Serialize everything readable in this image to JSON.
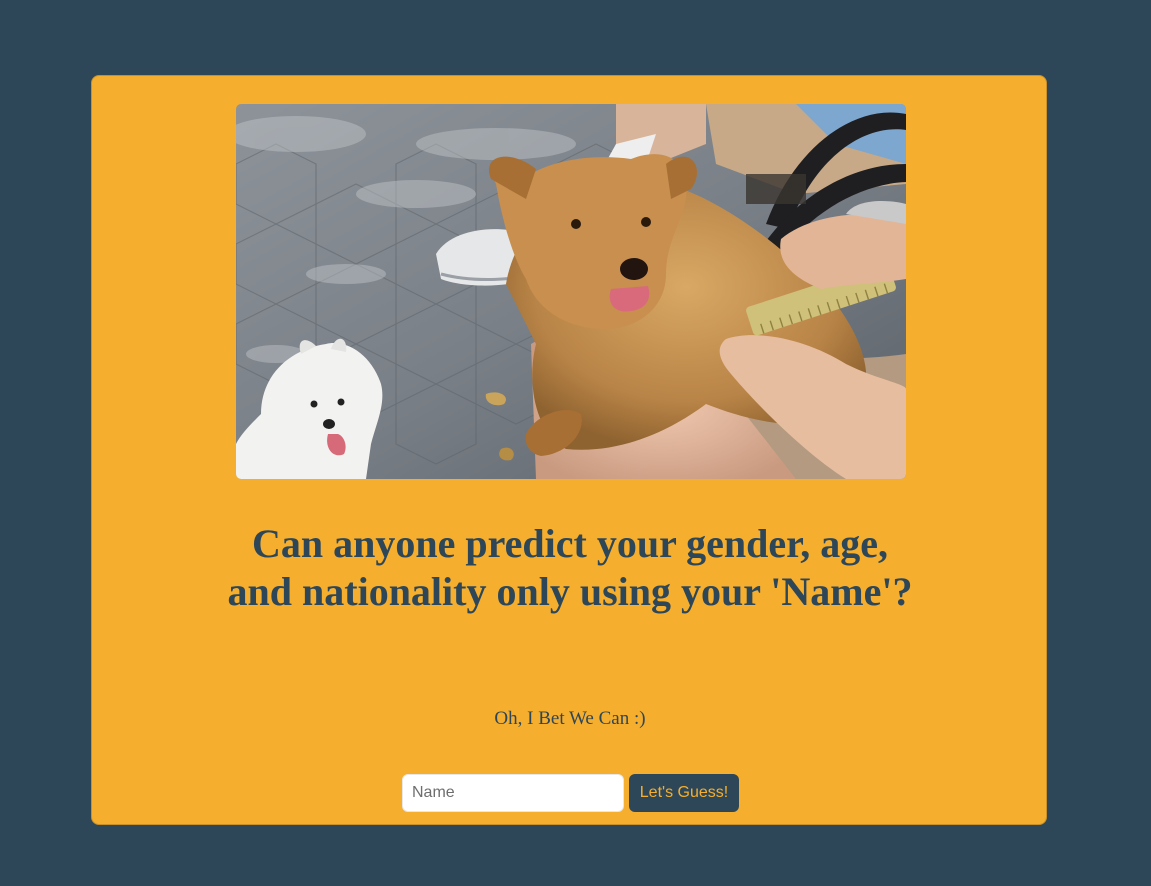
{
  "page": {
    "background": "#2e4758",
    "accent": "#f5ae2d"
  },
  "hero_image": {
    "alt": "Two dogs at a park, a brown terrier being combed and a small white terrier"
  },
  "headline": "Can anyone predict your gender, age, and nationality only using your 'Name'?",
  "tagline": "Oh, I Bet We Can :)",
  "form": {
    "name_placeholder": "Name",
    "name_value": "",
    "submit_label": "Let's Guess!"
  }
}
